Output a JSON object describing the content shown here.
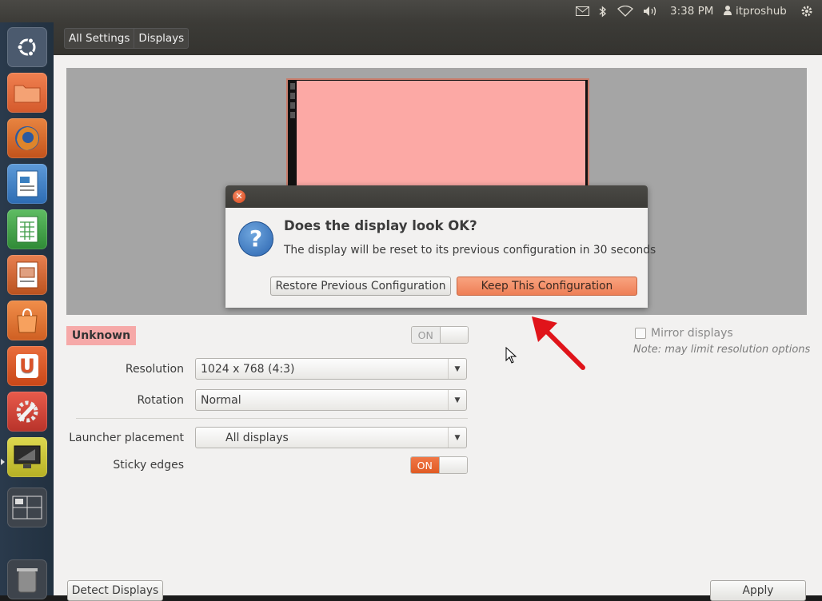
{
  "top_panel": {
    "clock": "3:38 PM",
    "user": "itproshub",
    "icons": [
      "mail-icon",
      "bluetooth-icon",
      "wifi-icon",
      "volume-icon",
      "user-icon",
      "gear-icon"
    ]
  },
  "launcher": {
    "items": [
      {
        "name": "dash-home",
        "color": "#4b5a6e"
      },
      {
        "name": "files",
        "color": "#e06a3b"
      },
      {
        "name": "firefox",
        "color": "#d9692b"
      },
      {
        "name": "libreoffice-writer",
        "color": "#3a7fc0"
      },
      {
        "name": "libreoffice-calc",
        "color": "#3b9a44"
      },
      {
        "name": "libreoffice-impress",
        "color": "#c85a2a"
      },
      {
        "name": "ubuntu-software-center",
        "color": "#d9702f"
      },
      {
        "name": "ubuntu-one",
        "color": "#d9532a"
      },
      {
        "name": "system-settings",
        "color": "#d4463a"
      },
      {
        "name": "displays",
        "color": "#c7c33a"
      },
      {
        "name": "workspace-switcher",
        "color": "#3e444c"
      },
      {
        "name": "trash",
        "color": "#3e444c"
      }
    ]
  },
  "header": {
    "breadcrumbs": [
      "All Settings",
      "Displays"
    ]
  },
  "dialog": {
    "heading": "Does the display look OK?",
    "message": "The display will be reset to its previous configuration in 30 seconds",
    "restore_label": "Restore Previous Configuration",
    "keep_label": "Keep This Configuration"
  },
  "monitor": {
    "name": "Unknown",
    "power_toggle": "ON"
  },
  "settings": {
    "resolution_label": "Resolution",
    "resolution_value": "1024 x 768 (4:3)",
    "rotation_label": "Rotation",
    "rotation_value": "Normal",
    "launcher_placement_label": "Launcher placement",
    "launcher_placement_value": "All displays",
    "sticky_edges_label": "Sticky edges",
    "sticky_edges_toggle": "ON",
    "mirror_label": "Mirror displays",
    "mirror_note": "Note: may limit resolution options"
  },
  "footer": {
    "detect_label": "Detect Displays",
    "apply_label": "Apply"
  },
  "colors": {
    "accent_orange": "#ee7f55",
    "monitor_pink": "#fca9a5",
    "panel_dark": "#3c3b37"
  }
}
